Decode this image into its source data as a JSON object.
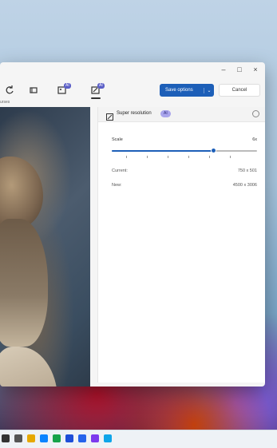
{
  "window": {
    "controls": {
      "minimize": "–",
      "maximize": "□",
      "close": "×"
    }
  },
  "toolbar": {
    "tools": [
      {
        "icon": "rotate-icon"
      },
      {
        "icon": "crop-icon"
      },
      {
        "icon": "image-ai-icon",
        "badge": "AI"
      },
      {
        "icon": "super-resolution-icon",
        "badge": "AI"
      }
    ],
    "save_label": "Save options",
    "cancel_label": "Cancel",
    "subcaption": "urses"
  },
  "panel": {
    "title": "Super resolution",
    "badge": "AI",
    "scale_label": "Scale",
    "scale_value": "6x",
    "slider_fraction": 0.7,
    "current_label": "Current:",
    "current_value": "750 x 501",
    "new_label": "New:",
    "new_value": "4500 x 3006"
  },
  "colors": {
    "accent": "#1d5fb8",
    "ai_badge": "#5b5fc7"
  }
}
